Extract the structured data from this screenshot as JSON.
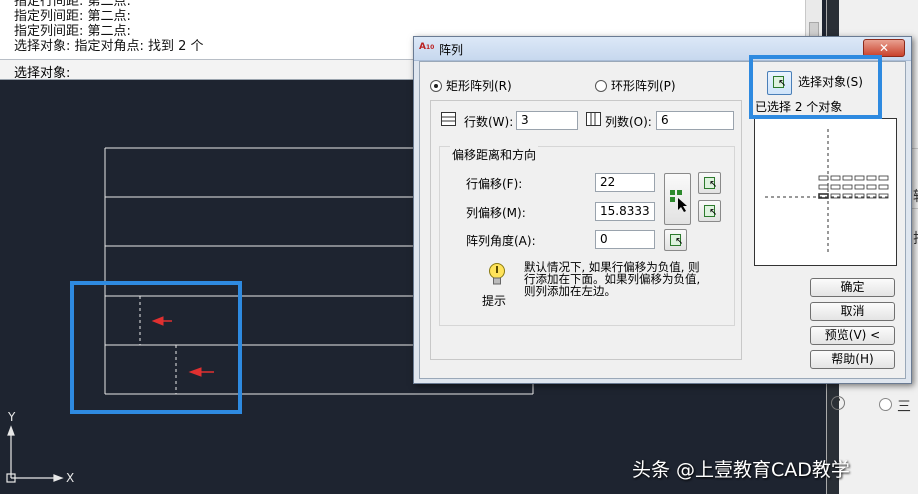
{
  "command_line": {
    "history": [
      "指定行间距:  第二点:",
      "指定列间距:  第二点:",
      "指定列间距:  第二点:",
      "选择对象: 指定对角点: 找到 2 个"
    ],
    "prompt": "选择对象:"
  },
  "ucs": {
    "x_label": "X",
    "y_label": "Y"
  },
  "dialog": {
    "title": "阵列",
    "close_label": "✕",
    "rect_array_label": "矩形阵列(R)",
    "polar_array_label": "环形阵列(P)",
    "rect_selected": true,
    "rows_label": "行数(W):",
    "rows_value": "3",
    "cols_label": "列数(O):",
    "cols_value": "6",
    "offset_group_label": "偏移距离和方向",
    "row_offset_label": "行偏移(F):",
    "row_offset_value": "22",
    "col_offset_label": "列偏移(M):",
    "col_offset_value": "15.8333",
    "angle_label": "阵列角度(A):",
    "angle_value": "0",
    "tip_text_1": "默认情况下, 如果行偏移为负值, 则",
    "tip_text_2": "行添加在下面。如果列偏移为负值,",
    "tip_text_3": "则列添加在左边。",
    "tip_label": "提示",
    "select_objects_label": "选择对象(S)",
    "selected_count_text": "已选择 2 个对象",
    "ok_label": "确定",
    "cancel_label": "取消",
    "preview_label": "预览(V) <",
    "help_label": "帮助(H)"
  },
  "side_text": {
    "c1": "转",
    "c2": "拉",
    "c3": "三",
    "help": "?"
  },
  "watermark": "头条 @上壹教育CAD教学",
  "colors": {
    "highlight": "#2e8ae0",
    "arrow": "#e03030",
    "lines": "#e8e8e8",
    "canvas": "#1e2430"
  }
}
